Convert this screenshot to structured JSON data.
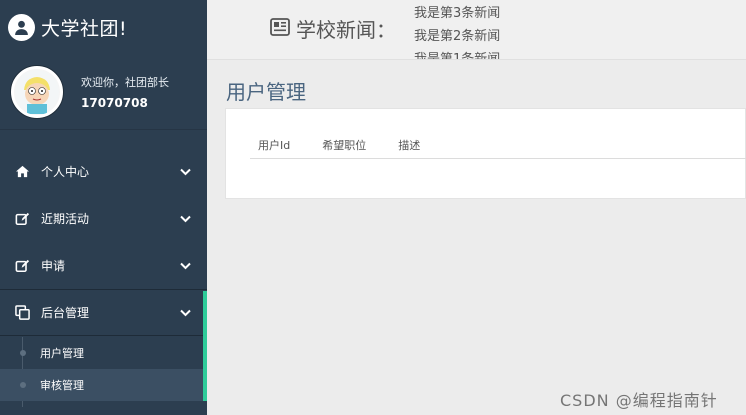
{
  "brand": {
    "title": "大学社团!"
  },
  "user": {
    "welcome": "欢迎你，社团部长",
    "id": "17070708"
  },
  "menu": {
    "items": [
      {
        "label": "个人中心",
        "icon": "home-icon"
      },
      {
        "label": "近期活动",
        "icon": "edit-icon"
      },
      {
        "label": "申请",
        "icon": "edit-icon"
      },
      {
        "label": "后台管理",
        "icon": "copy-icon"
      }
    ],
    "submenu": [
      {
        "label": "用户管理"
      },
      {
        "label": "审核管理"
      }
    ]
  },
  "header": {
    "news_title": "学校新闻：",
    "news": [
      "我是第3条新闻",
      "我是第2条新闻",
      "我是第1条新闻"
    ]
  },
  "main": {
    "page_title": "用户管理",
    "table": {
      "columns": [
        "用户Id",
        "希望职位",
        "描述"
      ]
    }
  },
  "watermark": "CSDN @编程指南针",
  "colors": {
    "sidebar": "#2c3e50",
    "accent": "#2ecc9a",
    "title": "#4a6580"
  }
}
